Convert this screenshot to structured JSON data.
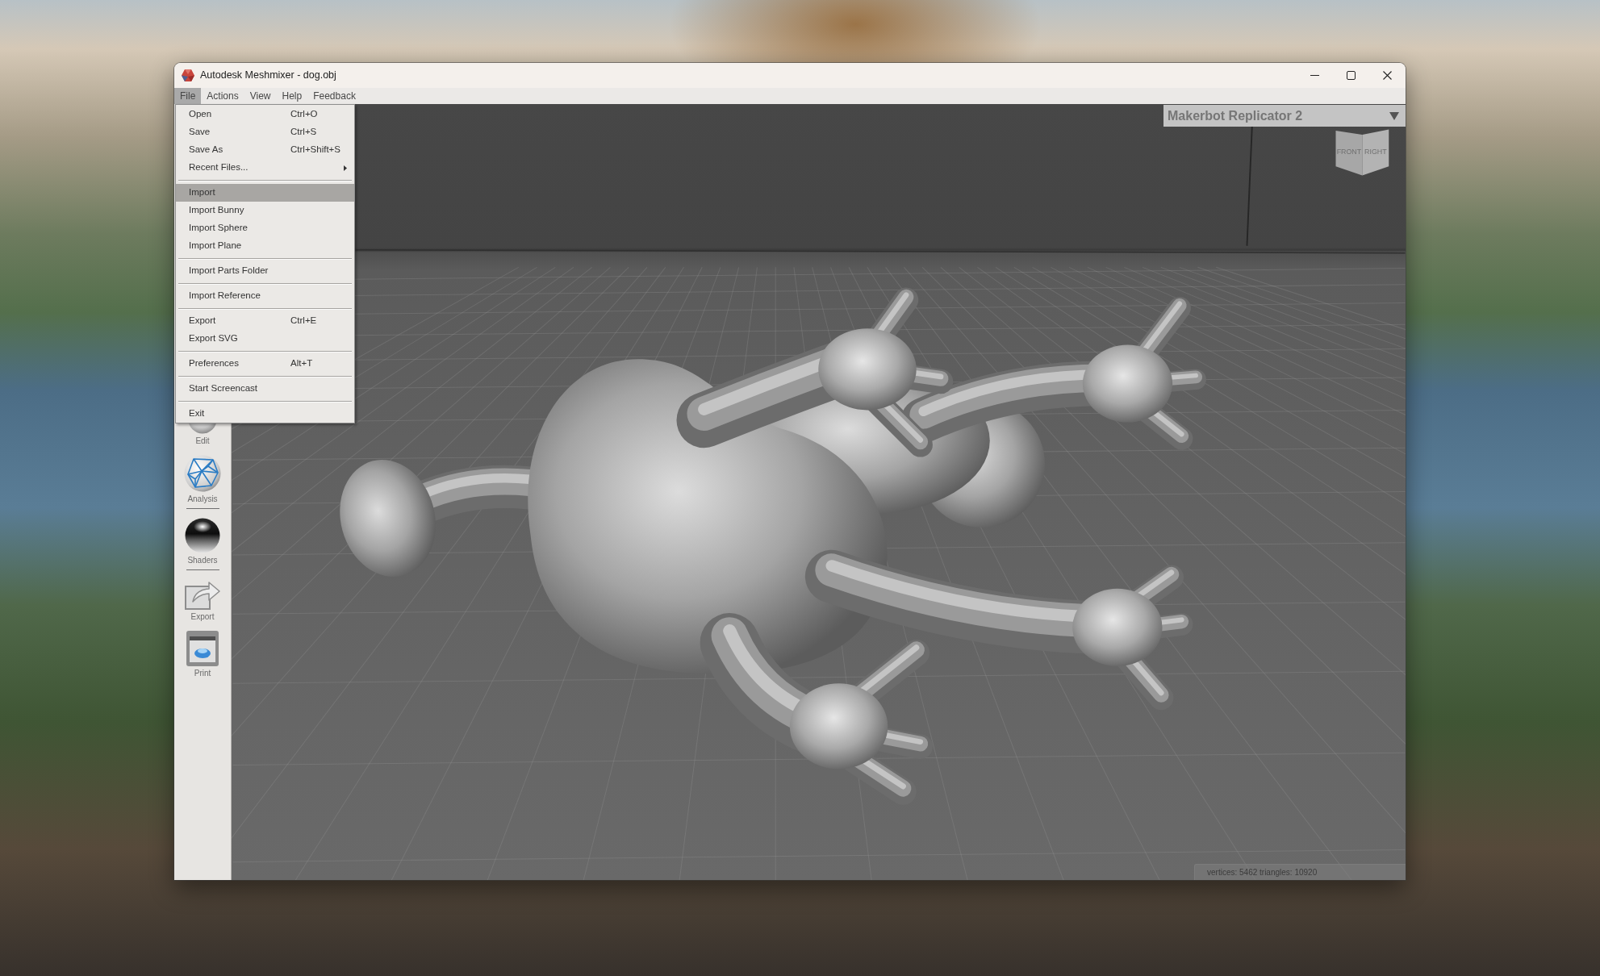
{
  "window": {
    "title": "Autodesk Meshmixer - dog.obj"
  },
  "menu_bar": [
    {
      "label": "File",
      "selected": true
    },
    {
      "label": "Actions",
      "selected": false
    },
    {
      "label": "View",
      "selected": false
    },
    {
      "label": "Help",
      "selected": false
    },
    {
      "label": "Feedback",
      "selected": false
    }
  ],
  "file_menu": {
    "sections": [
      {
        "items": [
          {
            "label": "Open",
            "shortcut": "Ctrl+O",
            "submenu": false,
            "selected": false
          },
          {
            "label": "Save",
            "shortcut": "Ctrl+S",
            "submenu": false,
            "selected": false
          },
          {
            "label": "Save As",
            "shortcut": "Ctrl+Shift+S",
            "submenu": false,
            "selected": false
          },
          {
            "label": "Recent Files...",
            "submenu": true,
            "selected": false
          }
        ]
      },
      {
        "items": [
          {
            "label": "Import",
            "submenu": false,
            "selected": true
          },
          {
            "label": "Import Bunny",
            "submenu": false,
            "selected": false
          },
          {
            "label": "Import Sphere",
            "submenu": false,
            "selected": false
          },
          {
            "label": "Import Plane",
            "submenu": false,
            "selected": false
          }
        ]
      },
      {
        "items": [
          {
            "label": "Import Parts Folder",
            "submenu": false,
            "selected": false
          }
        ]
      },
      {
        "items": [
          {
            "label": "Import Reference",
            "submenu": false,
            "selected": false
          }
        ]
      },
      {
        "items": [
          {
            "label": "Export",
            "shortcut": "Ctrl+E",
            "submenu": false,
            "selected": false
          },
          {
            "label": "Export SVG",
            "submenu": false,
            "selected": false
          }
        ]
      },
      {
        "items": [
          {
            "label": "Preferences",
            "shortcut": "Alt+T",
            "submenu": false,
            "selected": false
          }
        ]
      },
      {
        "items": [
          {
            "label": "Start Screencast",
            "submenu": false,
            "selected": false
          }
        ]
      },
      {
        "items": [
          {
            "label": "Exit",
            "submenu": false,
            "selected": false
          }
        ]
      }
    ]
  },
  "toolbar": {
    "groups": [
      [
        {
          "kind": "edit",
          "label": "Edit"
        },
        {
          "kind": "analysis",
          "label": "Analysis"
        }
      ],
      [
        {
          "kind": "shaders",
          "label": "Shaders"
        }
      ],
      [
        {
          "kind": "export",
          "label": "Export"
        },
        {
          "kind": "print",
          "label": "Print"
        }
      ]
    ]
  },
  "viewport": {
    "printer": "Makerbot Replicator 2",
    "view_cube": {
      "faces": [
        "FRONT",
        "RIGHT"
      ]
    },
    "status": "vertices: 5462 triangles: 10920"
  }
}
